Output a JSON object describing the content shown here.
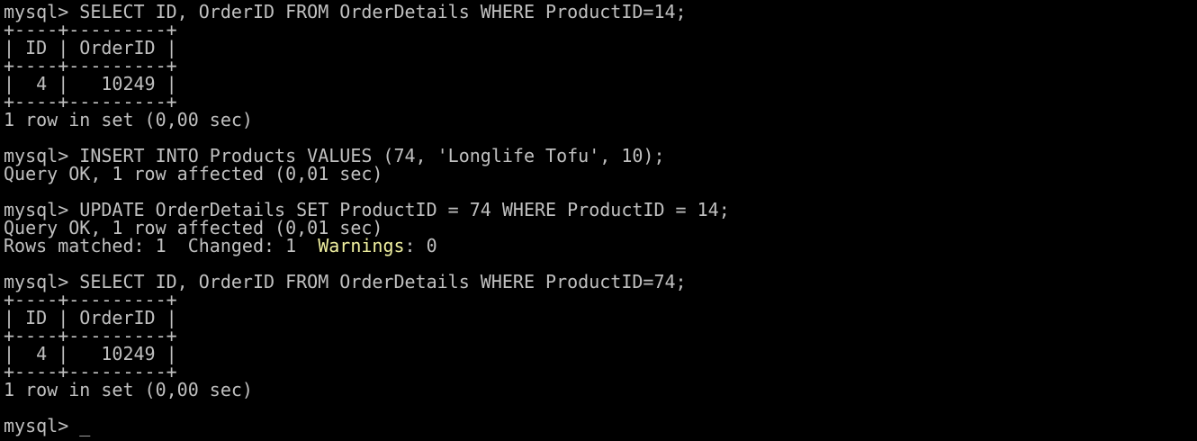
{
  "colors": {
    "background": "#000000",
    "text": "#c0c0c0",
    "warning": "#f0f0a0"
  },
  "lines": [
    "mysql> SELECT ID, OrderID FROM OrderDetails WHERE ProductID=14;",
    "+----+---------+",
    "| ID | OrderID |",
    "+----+---------+",
    "|  4 |   10249 |",
    "+----+---------+",
    "1 row in set (0,00 sec)",
    "",
    "mysql> INSERT INTO Products VALUES (74, 'Longlife Tofu', 10);",
    "Query OK, 1 row affected (0,01 sec)",
    "",
    "mysql> UPDATE OrderDetails SET ProductID = 74 WHERE ProductID = 14;",
    "Query OK, 1 row affected (0,01 sec)"
  ],
  "rows_matched": {
    "prefix": "Rows matched: 1  Changed: 1  ",
    "warnings_label": "Warnings",
    "suffix": ": 0"
  },
  "lines2": [
    "",
    "mysql> SELECT ID, OrderID FROM OrderDetails WHERE ProductID=74;",
    "+----+---------+",
    "| ID | OrderID |",
    "+----+---------+",
    "|  4 |   10249 |",
    "+----+---------+",
    "1 row in set (0,00 sec)",
    ""
  ],
  "prompt": {
    "text": "mysql> ",
    "cursor": "_"
  }
}
